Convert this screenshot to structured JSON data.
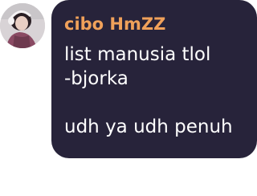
{
  "message": {
    "sender_name": "cibo HmZZ",
    "text": "list manusia tlol\n-bjorka\n\nudh ya udh penuh"
  },
  "colors": {
    "bubble_background": "#27233a",
    "sender_name": "#f0a15a",
    "message_text": "#ffffff"
  },
  "avatar": {
    "icon": "profile-photo"
  }
}
